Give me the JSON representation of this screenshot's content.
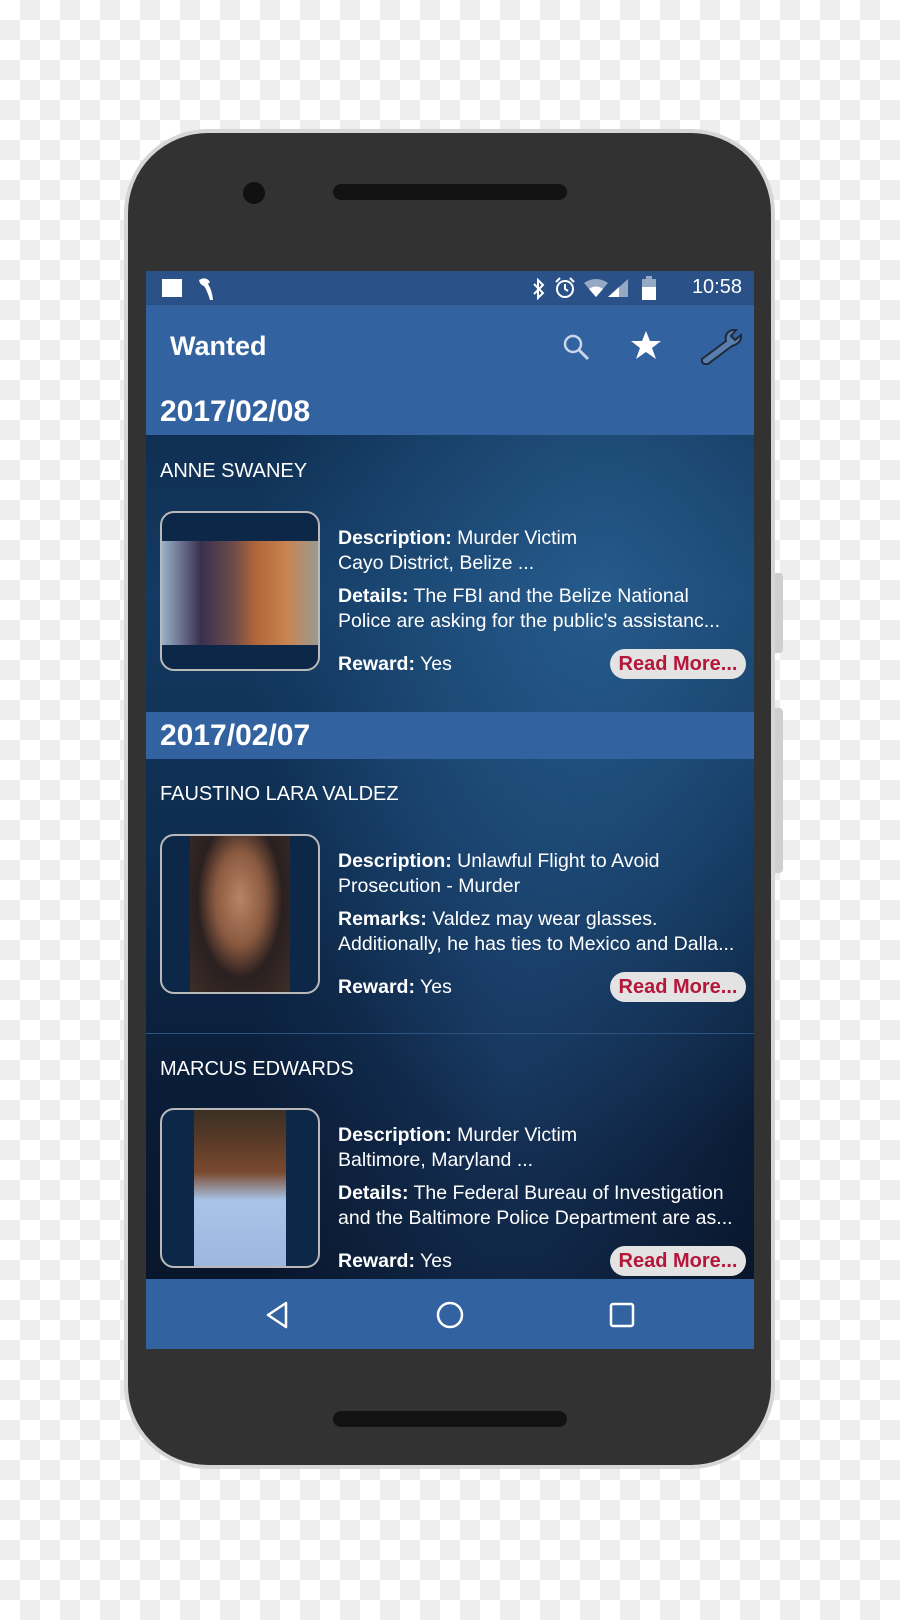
{
  "status_bar": {
    "time": "10:58",
    "left_icons": [
      "sonos-icon",
      "parrot-icon"
    ],
    "right_icons": [
      "bluetooth-icon",
      "alarm-icon",
      "wifi-icon",
      "signal-icon",
      "battery-icon"
    ]
  },
  "app_bar": {
    "title": "Wanted",
    "actions": [
      "search-icon",
      "star-icon",
      "wrench-icon"
    ]
  },
  "sections": [
    {
      "date": "2017/02/08",
      "entries": [
        {
          "name": "ANNE SWANEY",
          "line1_label": "Description:",
          "line1_value": " Murder Victim",
          "line2": "Cayo District, Belize ...",
          "line3_label": "Details:",
          "line3_value": " The FBI and the Belize National",
          "line4": "Police are asking for the public's assistanc...",
          "reward_label": "Reward:",
          "reward_value": " Yes",
          "read_more": "Read More..."
        }
      ]
    },
    {
      "date": "2017/02/07",
      "entries": [
        {
          "name": "FAUSTINO LARA VALDEZ",
          "line1_label": "Description:",
          "line1_value": " Unlawful Flight to Avoid",
          "line2": "Prosecution - Murder",
          "line3_label": "Remarks:",
          "line3_value": " Valdez may wear glasses.",
          "line4": "Additionally, he has ties to Mexico and Dalla...",
          "reward_label": "Reward:",
          "reward_value": " Yes",
          "read_more": "Read More..."
        },
        {
          "name": "MARCUS EDWARDS",
          "line1_label": "Description:",
          "line1_value": " Murder Victim",
          "line2": "Baltimore, Maryland ...",
          "line3_label": "Details:",
          "line3_value": " The Federal Bureau of Investigation",
          "line4": "and the Baltimore Police Department are as...",
          "reward_label": "Reward:",
          "reward_value": " Yes",
          "read_more": "Read More..."
        }
      ]
    }
  ],
  "nav_bar": [
    "back-icon",
    "home-icon",
    "recents-icon"
  ],
  "colors": {
    "primary": "#3362a1",
    "status_bar": "#2a5288",
    "read_more_text": "#b5173a"
  }
}
